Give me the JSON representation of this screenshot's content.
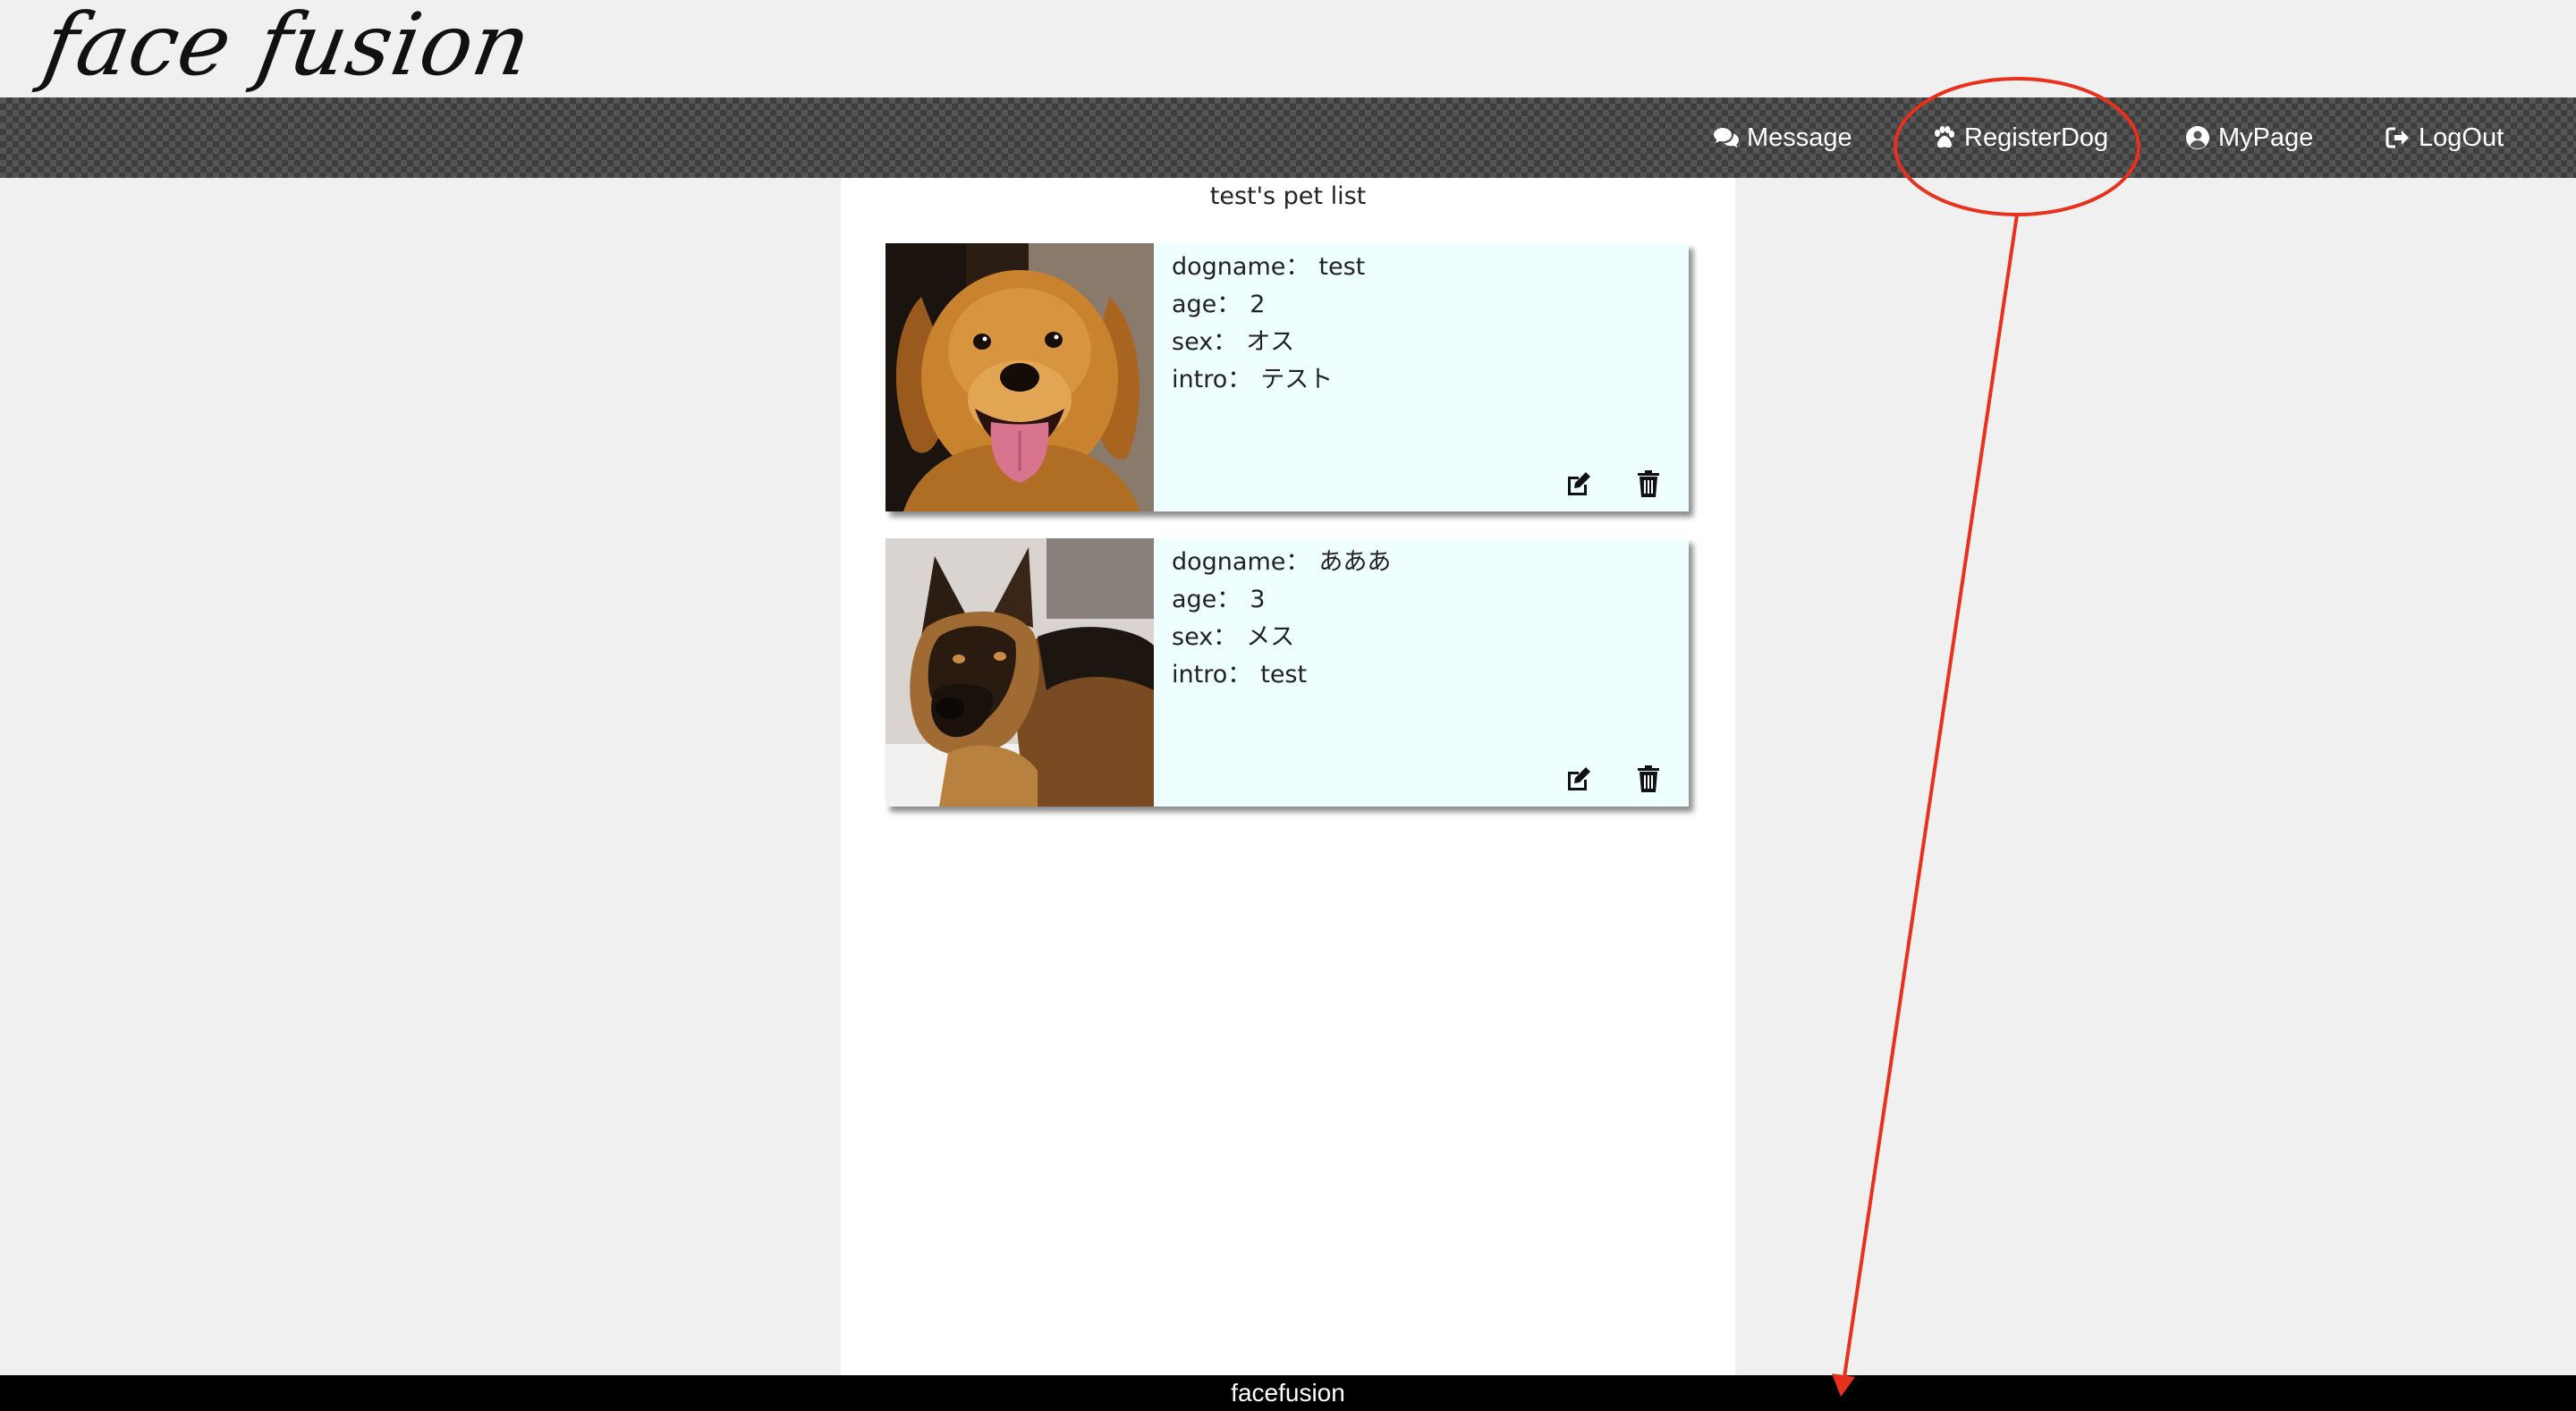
{
  "header": {
    "logo_text": "face fusion"
  },
  "nav": {
    "message": {
      "label": "Message",
      "icon": "comments-icon"
    },
    "register_dog": {
      "label": "RegisterDog",
      "icon": "paw-icon"
    },
    "mypage": {
      "label": "MyPage",
      "icon": "user-circle-icon"
    },
    "logout": {
      "label": "LogOut",
      "icon": "sign-out-icon"
    }
  },
  "main": {
    "title": "test's pet list",
    "fields": {
      "dogname": "dogname：",
      "age": "age：",
      "sex": "sex：",
      "intro": "intro："
    },
    "pets": [
      {
        "dogname": "test",
        "age": "2",
        "sex": "オス",
        "intro": "テスト",
        "photo": "golden-retriever-photo"
      },
      {
        "dogname": "あああ",
        "age": "3",
        "sex": "メス",
        "intro": "test",
        "photo": "german-shepherd-photo"
      }
    ]
  },
  "footer": {
    "text": "facefusion"
  },
  "annotation": {
    "color": "#e8301c",
    "target": "register-dog"
  },
  "colors": {
    "card_background": "#efffff",
    "footer_background": "#000000",
    "page_background": "#f0f0f0"
  }
}
